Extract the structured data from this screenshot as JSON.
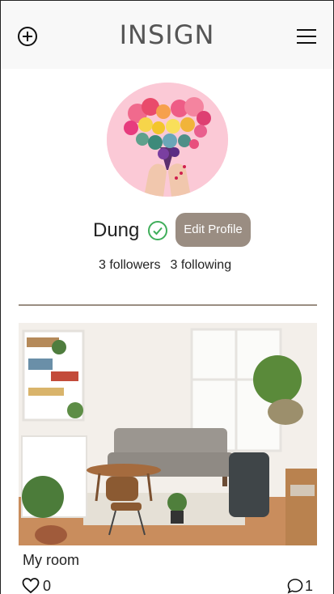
{
  "header": {
    "brand": "INSIGN",
    "add_icon": "plus-circle-icon",
    "menu_icon": "hamburger-menu-icon"
  },
  "profile": {
    "username": "Dung",
    "verified_icon": "check-circle-icon",
    "edit_label": "Edit Profile",
    "followers_text": "3 followers",
    "following_text": "3 following"
  },
  "post": {
    "title": "My room",
    "likes": "0",
    "comments": "1"
  },
  "colors": {
    "accent": "#9a8d82",
    "verified": "#3fae5a",
    "header_bg": "#f8f8f8"
  }
}
